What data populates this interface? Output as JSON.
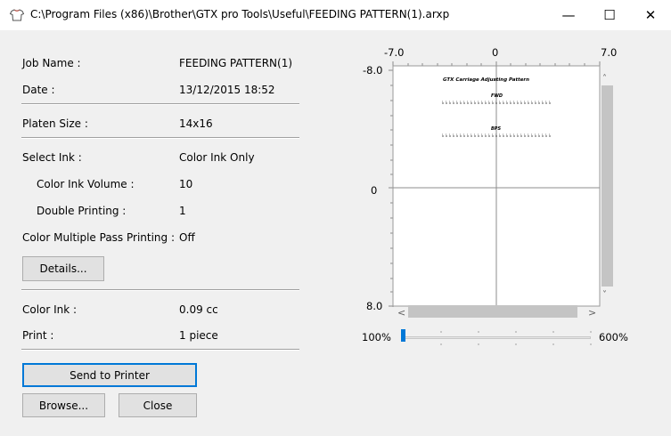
{
  "window": {
    "title": "C:\\Program Files (x86)\\Brother\\GTX pro Tools\\Useful\\FEEDING PATTERN(1).arxp",
    "minimize": "—",
    "maximize": "☐",
    "close": "✕"
  },
  "info": {
    "job_name_label": "Job Name :",
    "job_name_value": "FEEDING PATTERN(1)",
    "date_label": "Date :",
    "date_value": "13/12/2015 18:52",
    "platen_size_label": "Platen Size :",
    "platen_size_value": "14x16",
    "select_ink_label": "Select Ink :",
    "select_ink_value": "Color Ink Only",
    "color_ink_volume_label": "Color Ink Volume :",
    "color_ink_volume_value": "10",
    "double_printing_label": "Double Printing :",
    "double_printing_value": "1",
    "multi_pass_label": "Color Multiple Pass Printing :",
    "multi_pass_value": "Off",
    "details_button": "Details...",
    "color_ink_label": "Color Ink :",
    "color_ink_value": "0.09 cc",
    "print_label": "Print :",
    "print_value": "1 piece"
  },
  "buttons": {
    "send": "Send to Printer",
    "browse": "Browse...",
    "close": "Close"
  },
  "preview": {
    "x_min_label": "-7.0",
    "x_zero_label": "0",
    "x_max_label": "7.0",
    "y_min_label": "-8.0",
    "y_zero_label": "0",
    "y_max_label": "8.0",
    "pattern_title": "GTX Carriage Adjusting Pattern",
    "label_fwd": "FWD",
    "label_bps": "BPS",
    "zoom_value": "100%",
    "zoom_max": "600%",
    "zoom_fraction": 0.0
  }
}
